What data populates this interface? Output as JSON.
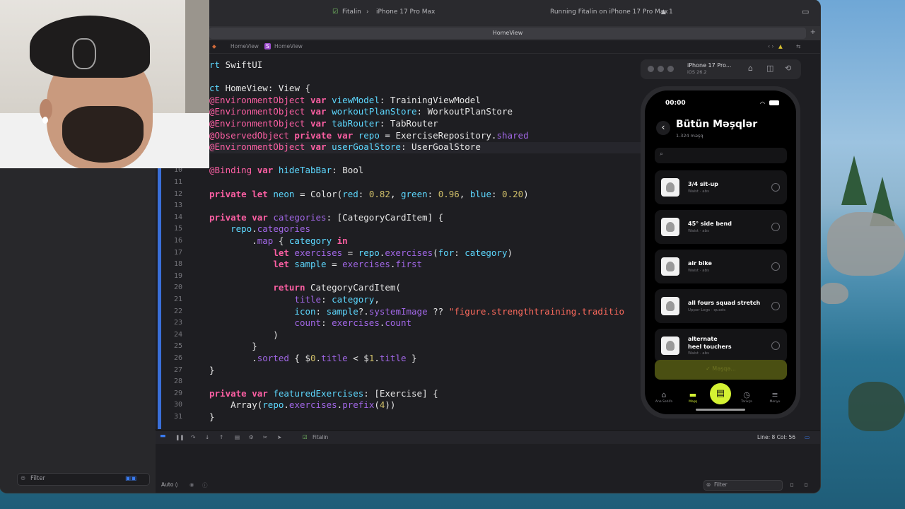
{
  "toolbar": {
    "scheme": "Fitalin",
    "device": "iPhone 17 Pro Max",
    "status": "Running Fitalin on iPhone 17 Pro Max",
    "warnings": "1"
  },
  "editor": {
    "tab_title": "HomeView",
    "breadcrumb": [
      "HomeView",
      "HomeView"
    ],
    "lines": [
      {
        "n": "",
        "t": "rt SwiftUI"
      },
      {
        "n": "",
        "t": ""
      },
      {
        "n": "",
        "t": "ct HomeView: View {"
      },
      {
        "n": "",
        "t": "@EnvironmentObject var viewModel: TrainingViewModel"
      },
      {
        "n": "",
        "t": "@EnvironmentObject var workoutPlanStore: WorkoutPlanStore"
      },
      {
        "n": "",
        "t": "@EnvironmentObject var tabRouter: TabRouter"
      },
      {
        "n": "",
        "t": "@ObservedObject private var repo = ExerciseRepository.shared"
      },
      {
        "n": "",
        "t": "@EnvironmentObject var userGoalStore: UserGoalStore"
      },
      {
        "n": "",
        "t": ""
      },
      {
        "n": "10",
        "t": "@Binding var hideTabBar: Bool"
      },
      {
        "n": "11",
        "t": ""
      },
      {
        "n": "12",
        "t": "private let neon = Color(red: 0.82, green: 0.96, blue: 0.20)"
      },
      {
        "n": "13",
        "t": ""
      },
      {
        "n": "14",
        "t": "private var categories: [CategoryCardItem] {"
      },
      {
        "n": "15",
        "t": "    repo.categories"
      },
      {
        "n": "16",
        "t": "        .map { category in"
      },
      {
        "n": "17",
        "t": "            let exercises = repo.exercises(for: category)"
      },
      {
        "n": "18",
        "t": "            let sample = exercises.first"
      },
      {
        "n": "19",
        "t": ""
      },
      {
        "n": "20",
        "t": "            return CategoryCardItem("
      },
      {
        "n": "21",
        "t": "                title: category,"
      },
      {
        "n": "22",
        "t": "                icon: sample?.systemImage ?? \"figure.strengthtraining.traditio"
      },
      {
        "n": "23",
        "t": "                count: exercises.count"
      },
      {
        "n": "24",
        "t": "            )"
      },
      {
        "n": "25",
        "t": "        }"
      },
      {
        "n": "26",
        "t": "        .sorted { $0.title < $1.title }"
      },
      {
        "n": "27",
        "t": "}"
      },
      {
        "n": "28",
        "t": ""
      },
      {
        "n": "29",
        "t": "private var featuredExercises: [Exercise] {"
      },
      {
        "n": "30",
        "t": "    Array(repo.exercises.prefix(4))"
      },
      {
        "n": "31",
        "t": "}"
      }
    ]
  },
  "debugbar": {
    "target": "Fitalin",
    "cursor": "Line: 8  Col: 56"
  },
  "console": {
    "mode": "Auto ◊",
    "filter_placeholder": "Filter"
  },
  "navigator": {
    "filter_placeholder": "Filter"
  },
  "simulator": {
    "device_name": "iPhone 17 Pro...",
    "os": "iOS 26.2"
  },
  "app": {
    "time": "00:00",
    "title": "Bütün Məşqlər",
    "subtitle": "1.324 məşq",
    "exercises": [
      {
        "name": "3/4 sit-up",
        "sub": "Waist · abs"
      },
      {
        "name": "45° side bend",
        "sub": "Waist · abs"
      },
      {
        "name": "air bike",
        "sub": "Waist · abs"
      },
      {
        "name": "all fours squad stretch",
        "sub": "Upper Legs · quads"
      },
      {
        "name": "alternate\nheel touchers",
        "sub": "Waist · abs"
      }
    ],
    "action_button": "✓ Məşqə...",
    "tabs": [
      {
        "label": "Ana Səhifə",
        "icon": "home-icon"
      },
      {
        "label": "Məşq",
        "icon": "dumbbell-icon"
      },
      {
        "label": "Tarixçə",
        "icon": "history-icon"
      },
      {
        "label": "Menyu",
        "icon": "menu-icon"
      }
    ]
  },
  "colors": {
    "neon": "#d4f233",
    "editor_bg": "#1e1e22",
    "keyword": "#fc5fa3",
    "type": "#5dd8ff",
    "string": "#fc6a5d",
    "number": "#d0bf69",
    "property": "#a167e6"
  }
}
